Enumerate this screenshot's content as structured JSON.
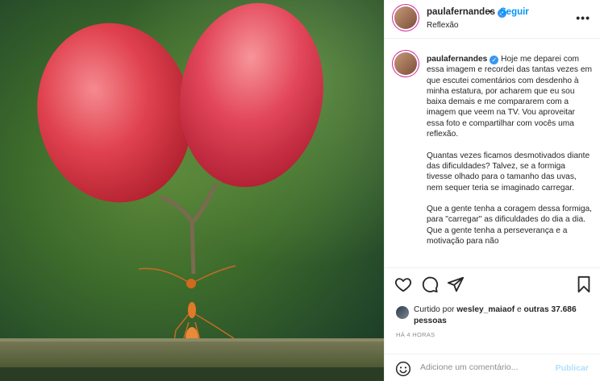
{
  "post": {
    "username": "paulafernandes",
    "verified": true,
    "follow_label": "Seguir",
    "separator": "•",
    "location": "Reflexão",
    "more_label": "•••"
  },
  "caption": {
    "username": "paulafernandes",
    "paragraphs": [
      "Hoje me deparei com essa imagem e recordei das tantas vezes em que escutei comentários com desdenho à minha estatura, por acharem que eu sou baixa demais e me compararem com a imagem que veem na TV. Vou aproveitar essa foto e compartilhar com vocês uma reflexão.",
      "Quantas vezes ficamos desmotivados diante das dificuldades? Talvez, se a formiga tivesse olhado para o tamanho das uvas, nem sequer teria se imaginado carregar.",
      "Que a gente tenha a coragem dessa formiga, para \"carregar\" as dificuldades do dia a dia. Que a gente tenha a perseverança e a motivação para não"
    ]
  },
  "actions": {
    "icons": [
      "heart-icon",
      "comment-icon",
      "share-icon",
      "bookmark-icon"
    ]
  },
  "likes": {
    "prefix": "Curtido por ",
    "liker": "wesley_maiaof",
    "middle": " e ",
    "others": "outras 37.686 pessoas"
  },
  "time_ago": "HÁ 4 HORAS",
  "comment": {
    "placeholder": "Adicione um comentário...",
    "post_label": "Publicar"
  },
  "colors": {
    "accent": "#0095f6",
    "verified": "#3897f0",
    "post_disabled": "#b2dffc",
    "grape": "#d83a4a"
  }
}
